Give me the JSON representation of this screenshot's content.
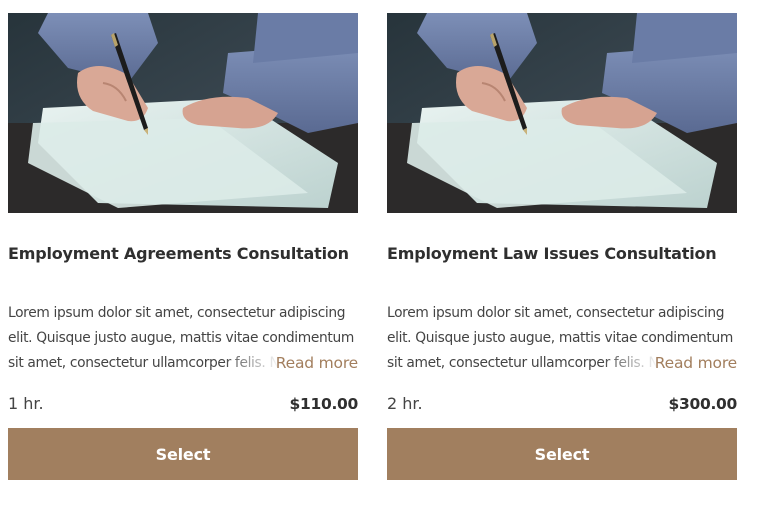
{
  "services": [
    {
      "image_alt": "person-signing-document-photo",
      "title": "Employment Agreements Consultation",
      "description": "Lorem ipsum dolor sit amet, consectetur adipiscing elit. Quisque justo augue, mattis vitae condimentum sit amet, consectetur ullamcorper felis. Nam tristique",
      "read_more_label": "Read more",
      "duration": "1 hr.",
      "price": "$110.00",
      "select_label": "Select"
    },
    {
      "image_alt": "person-signing-document-photo",
      "title": "Employment Law Issues Consultation",
      "description": "Lorem ipsum dolor sit amet, consectetur adipiscing elit. Quisque justo augue, mattis vitae condimentum sit amet, consectetur ullamcorper felis. Nam tristique",
      "read_more_label": "Read more",
      "duration": "2 hr.",
      "price": "$300.00",
      "select_label": "Select"
    }
  ],
  "colors": {
    "accent": "#a17f5f",
    "read_more": "#a27e5d",
    "title_text": "#2f2f2f",
    "body_text": "#444444"
  }
}
